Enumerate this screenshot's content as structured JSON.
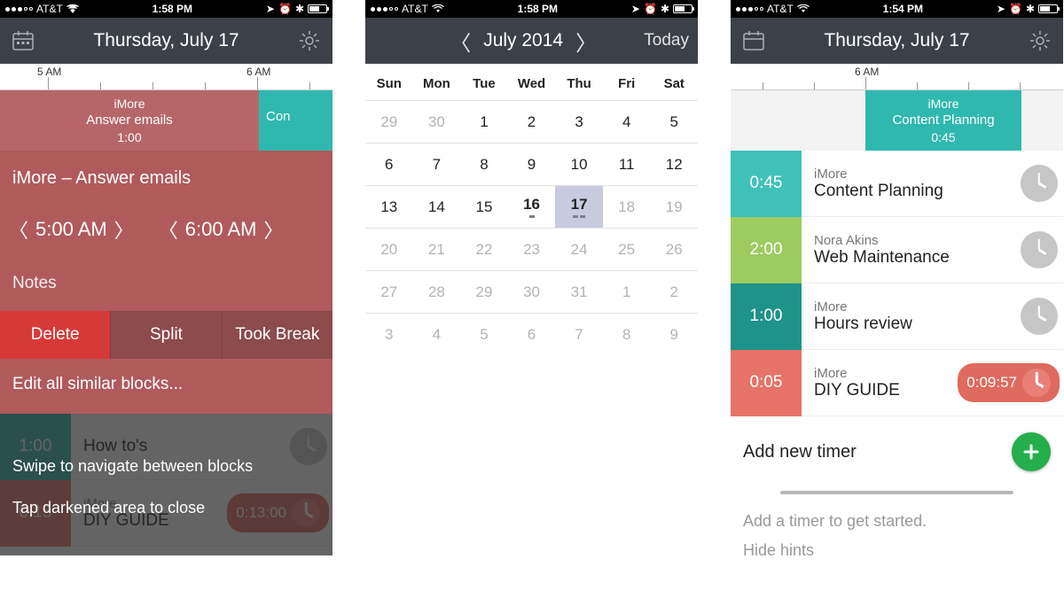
{
  "status": {
    "carrier": "AT&T",
    "wifi": true
  },
  "screen1": {
    "time": "1:58 PM",
    "title": "Thursday, July 17",
    "ruler": {
      "labels": [
        "5 AM",
        "6 AM"
      ]
    },
    "timeline": [
      {
        "project": "iMore",
        "task": "Answer emails",
        "duration": "1:00",
        "color": "red"
      },
      {
        "project": "",
        "task": "Con",
        "duration": "",
        "color": "teal"
      }
    ],
    "edit": {
      "title": "iMore – Answer emails",
      "start": "5:00 AM",
      "end": "6:00 AM",
      "notes_label": "Notes",
      "delete": "Delete",
      "split": "Split",
      "break": "Took Break",
      "similar": "Edit all similar blocks..."
    },
    "backdrop": {
      "rows": [
        {
          "duration": "1:00",
          "project": "",
          "task": "How to's",
          "color": "#2fb8b0"
        },
        {
          "duration": "0:15",
          "project": "iMore",
          "task": "DIY GUIDE",
          "timer": "0:13:00",
          "color": "#df6a5f"
        }
      ],
      "hint1": "Swipe to navigate between blocks",
      "hint2": "Tap darkened area to close"
    }
  },
  "screen2": {
    "time": "1:58 PM",
    "month": "July 2014",
    "today": "Today",
    "day_headers": [
      "Sun",
      "Mon",
      "Tue",
      "Wed",
      "Thu",
      "Fri",
      "Sat"
    ],
    "weeks": [
      [
        {
          "d": "29",
          "dim": true
        },
        {
          "d": "30",
          "dim": true
        },
        {
          "d": "1"
        },
        {
          "d": "2"
        },
        {
          "d": "3"
        },
        {
          "d": "4"
        },
        {
          "d": "5"
        }
      ],
      [
        {
          "d": "6"
        },
        {
          "d": "7"
        },
        {
          "d": "8"
        },
        {
          "d": "9"
        },
        {
          "d": "10"
        },
        {
          "d": "11"
        },
        {
          "d": "12"
        }
      ],
      [
        {
          "d": "13"
        },
        {
          "d": "14"
        },
        {
          "d": "15"
        },
        {
          "d": "16",
          "marks": 1,
          "bold": true
        },
        {
          "d": "17",
          "sel": true,
          "marks": 2
        },
        {
          "d": "18",
          "dim": true
        },
        {
          "d": "19",
          "dim": true
        }
      ],
      [
        {
          "d": "20",
          "dim": true
        },
        {
          "d": "21",
          "dim": true
        },
        {
          "d": "22",
          "dim": true
        },
        {
          "d": "23",
          "dim": true
        },
        {
          "d": "24",
          "dim": true
        },
        {
          "d": "25",
          "dim": true
        },
        {
          "d": "26",
          "dim": true
        }
      ],
      [
        {
          "d": "27",
          "dim": true
        },
        {
          "d": "28",
          "dim": true
        },
        {
          "d": "29",
          "dim": true
        },
        {
          "d": "30",
          "dim": true
        },
        {
          "d": "31",
          "dim": true
        },
        {
          "d": "1",
          "dim": true
        },
        {
          "d": "2",
          "dim": true
        }
      ],
      [
        {
          "d": "3",
          "dim": true
        },
        {
          "d": "4",
          "dim": true
        },
        {
          "d": "5",
          "dim": true
        },
        {
          "d": "6",
          "dim": true
        },
        {
          "d": "7",
          "dim": true
        },
        {
          "d": "8",
          "dim": true
        },
        {
          "d": "9",
          "dim": true
        }
      ]
    ]
  },
  "screen3": {
    "time": "1:54 PM",
    "title": "Thursday, July 17",
    "ruler": {
      "labels": [
        "6 AM"
      ]
    },
    "timeline": [
      {
        "project": "iMore",
        "task": "Content Planning",
        "duration": "0:45",
        "color": "teal"
      }
    ],
    "rows": [
      {
        "duration": "0:45",
        "project": "iMore",
        "task": "Content Planning",
        "color": "#3fc1ba"
      },
      {
        "duration": "2:00",
        "project": "Nora Akins",
        "task": "Web Maintenance",
        "color": "#9dcb5f"
      },
      {
        "duration": "1:00",
        "project": "iMore",
        "task": "Hours review",
        "color": "#1f928a"
      },
      {
        "duration": "0:05",
        "project": "iMore",
        "task": "DIY GUIDE",
        "timer": "0:09:57",
        "color": "#e57368"
      }
    ],
    "add_label": "Add new timer",
    "hint1": "Add a timer to get started.",
    "hint2": "Hide hints"
  }
}
